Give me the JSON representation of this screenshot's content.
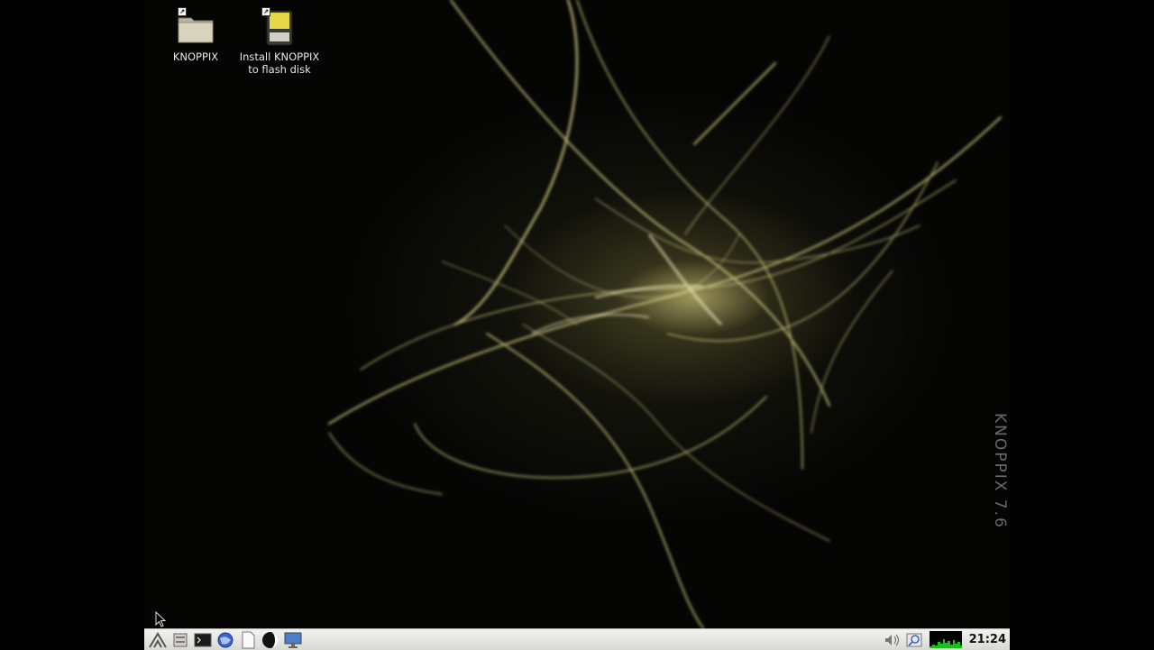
{
  "desktop": {
    "icons": [
      {
        "label": "KNOPPIX",
        "icon": "folder-icon"
      },
      {
        "label_line1": "Install KNOPPIX",
        "label_line2": "to flash disk",
        "icon": "flash-disk-icon"
      }
    ],
    "watermark": "KNOPPIX 7.6"
  },
  "taskbar": {
    "launchers": [
      "start-menu-icon",
      "file-manager-icon",
      "terminal-icon",
      "web-browser-icon",
      "text-editor-icon",
      "office-icon",
      "desktop-display-icon"
    ],
    "tray": {
      "icons": [
        "volume-icon",
        "network-icon",
        "cpu-monitor"
      ],
      "clock": "21:24"
    }
  },
  "colors": {
    "taskbar_bg": "#e6e6e1",
    "wallpaper_glow": "#e6dc8c",
    "cpu_graph": "#18c018"
  }
}
